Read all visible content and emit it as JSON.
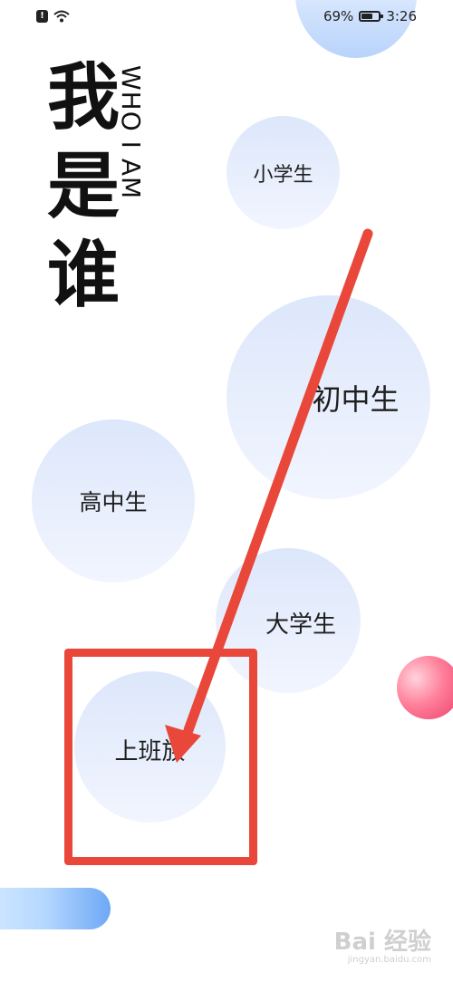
{
  "status_bar": {
    "battery_percent_label": "69%",
    "battery_level": 0.69,
    "time": "3:26",
    "icons": [
      "alert-icon",
      "wifi-icon",
      "battery-icon"
    ]
  },
  "title": {
    "chinese": "我\n是\n谁",
    "english": "WHO I AM"
  },
  "options": {
    "primary_school": "小学生",
    "middle_school": "初中生",
    "high_school": "高中生",
    "university": "大学生",
    "office_worker": "上班族"
  },
  "annotation": {
    "color": "#e8473a",
    "target": "上班族"
  },
  "colors": {
    "bubble_top": "#dde7fb",
    "bubble_bottom": "#f1f5fe",
    "pink_accent": "#ec3e6a",
    "blue_accent": "#6ea8f6"
  },
  "watermark": {
    "logo": "Bai 经验",
    "url": "jingyan.baidu.com"
  }
}
